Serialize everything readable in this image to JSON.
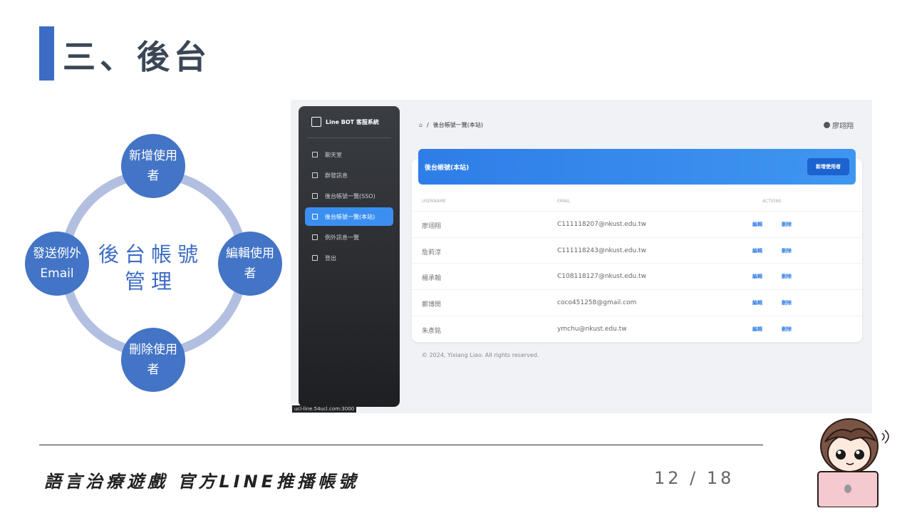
{
  "slide": {
    "title": "三、後台",
    "bottom_title": "語言治療遊戲 官方LINE推播帳號",
    "page_number": "12 / 18"
  },
  "diagram": {
    "center": "後台帳號管理",
    "nodes": {
      "top": "新增使用者",
      "right": "編輯使用者",
      "bottom": "刪除使用者",
      "left": "發送例外Email"
    }
  },
  "app": {
    "brand": "Line BOT 客服系統",
    "sidebar": [
      {
        "label": "聊天室"
      },
      {
        "label": "群發訊息"
      },
      {
        "label": "後台帳號一覽(SSO)"
      },
      {
        "label": "後台帳號一覽(本站)",
        "active": true
      },
      {
        "label": "例外訊息一覽"
      },
      {
        "label": "登出"
      }
    ],
    "url_status": "ucl-line.54ucl.com:3000",
    "breadcrumb": {
      "separator": "/",
      "current": "後台帳號一覽(本站)"
    },
    "current_user": "廖翊翔",
    "card_title": "後台帳號(本站)",
    "add_button": "新增使用者",
    "columns": {
      "username": "USERNAME",
      "email": "EMAIL",
      "actions": "ACTIONS"
    },
    "rows": [
      {
        "username": "廖翊翔",
        "email": "C111118207@nkust.edu.tw",
        "edit": "編輯",
        "delete": "刪除"
      },
      {
        "username": "詹莉淳",
        "email": "C111118243@nkust.edu.tw",
        "edit": "編輯",
        "delete": "刪除"
      },
      {
        "username": "楊承翰",
        "email": "C108118127@nkust.edu.tw",
        "edit": "編輯",
        "delete": "刪除"
      },
      {
        "username": "鄭博閔",
        "email": "coco451258@gmail.com",
        "edit": "編輯",
        "delete": "刪除"
      },
      {
        "username": "朱彥銘",
        "email": "ymchu@nkust.edu.tw",
        "edit": "編輯",
        "delete": "刪除"
      }
    ],
    "footer": "© 2024, Yixiang Liao. All rights reserved."
  },
  "colors": {
    "accent": "#3d6cc4",
    "node": "#4374c6",
    "ring": "#b3bfe0",
    "header_blue": "#2e7de8"
  }
}
